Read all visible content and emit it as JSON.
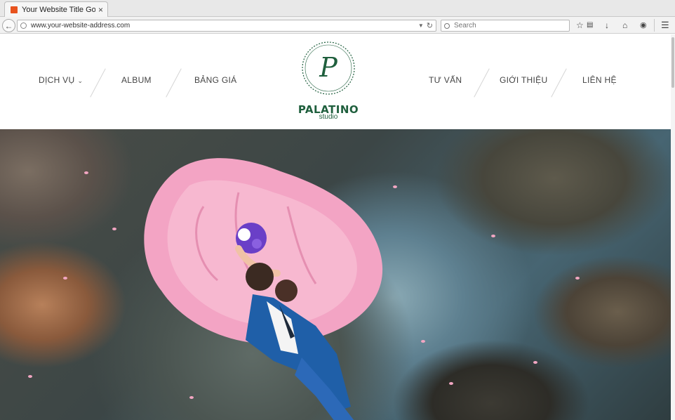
{
  "browser": {
    "tab_title": "Your Website Title Goes ...",
    "tab_close": "×",
    "url": "www.your-website-address.com",
    "search_placeholder": "Search",
    "icons": [
      "back-arrow-icon",
      "globe-icon",
      "dropdown-icon",
      "reload-icon",
      "search-icon",
      "bookmark-star-icon",
      "reading-list-icon",
      "download-icon",
      "home-icon",
      "chat-icon",
      "menu-icon"
    ]
  },
  "site": {
    "nav_left": [
      {
        "label": "DỊCH VỤ",
        "has_dropdown": true
      },
      {
        "label": "ALBUM"
      },
      {
        "label": "BẢNG GIÁ"
      }
    ],
    "nav_right": [
      {
        "label": "TƯ VẤN"
      },
      {
        "label": "GIỚI THIỆU"
      },
      {
        "label": "LIÊN HỆ"
      }
    ],
    "logo": {
      "monogram": "P",
      "brand": "PALATINO",
      "sub": "studio",
      "color": "#1f5f3d"
    },
    "hero": {
      "description_color_accent": "#f2a6c2"
    }
  }
}
